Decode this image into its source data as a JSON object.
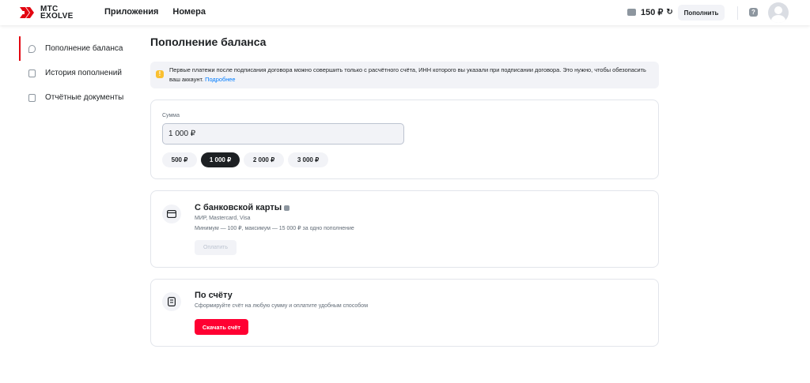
{
  "brand": {
    "line1": "МТС",
    "line2": "EXOLVE",
    "accent": "#e30611"
  },
  "nav": {
    "items": [
      "Приложения",
      "Номера"
    ]
  },
  "header": {
    "balance": "150 ₽",
    "topup_label": "Пополнить",
    "help_icon": "?"
  },
  "sidebar": {
    "items": [
      {
        "label": "Пополнение баланса",
        "active": true,
        "icon": "speech-bubble-icon"
      },
      {
        "label": "История пополнений",
        "active": false,
        "icon": "history-doc-icon"
      },
      {
        "label": "Отчётные документы",
        "active": false,
        "icon": "document-icon"
      }
    ]
  },
  "page": {
    "title": "Пополнение баланса"
  },
  "notice": {
    "text": "Первые платежи после подписания договора можно совершить только с расчётного счёта, ИНН которого вы указали при подписании договора. Это нужно, чтобы обезопасить ваш аккаунт.",
    "link": "Подробнее",
    "icon": "!"
  },
  "amount": {
    "label": "Сумма",
    "value": "1 000 ₽",
    "chips": [
      "500 ₽",
      "1 000 ₽",
      "2 000 ₽",
      "3 000 ₽"
    ],
    "selected_chip": "1 000 ₽"
  },
  "bank_card": {
    "title": "С банковской карты",
    "networks": "МИР, Mastercard, Visa",
    "limits": "Минимум — 100 ₽, максимум — 15 000 ₽ за одно пополнение",
    "pay_label": "Оплатить"
  },
  "invoice": {
    "title": "По счёту",
    "desc": "Сформируйте счёт на любую сумму и оплатите удобным способом",
    "button_label": "Скачать счёт"
  }
}
